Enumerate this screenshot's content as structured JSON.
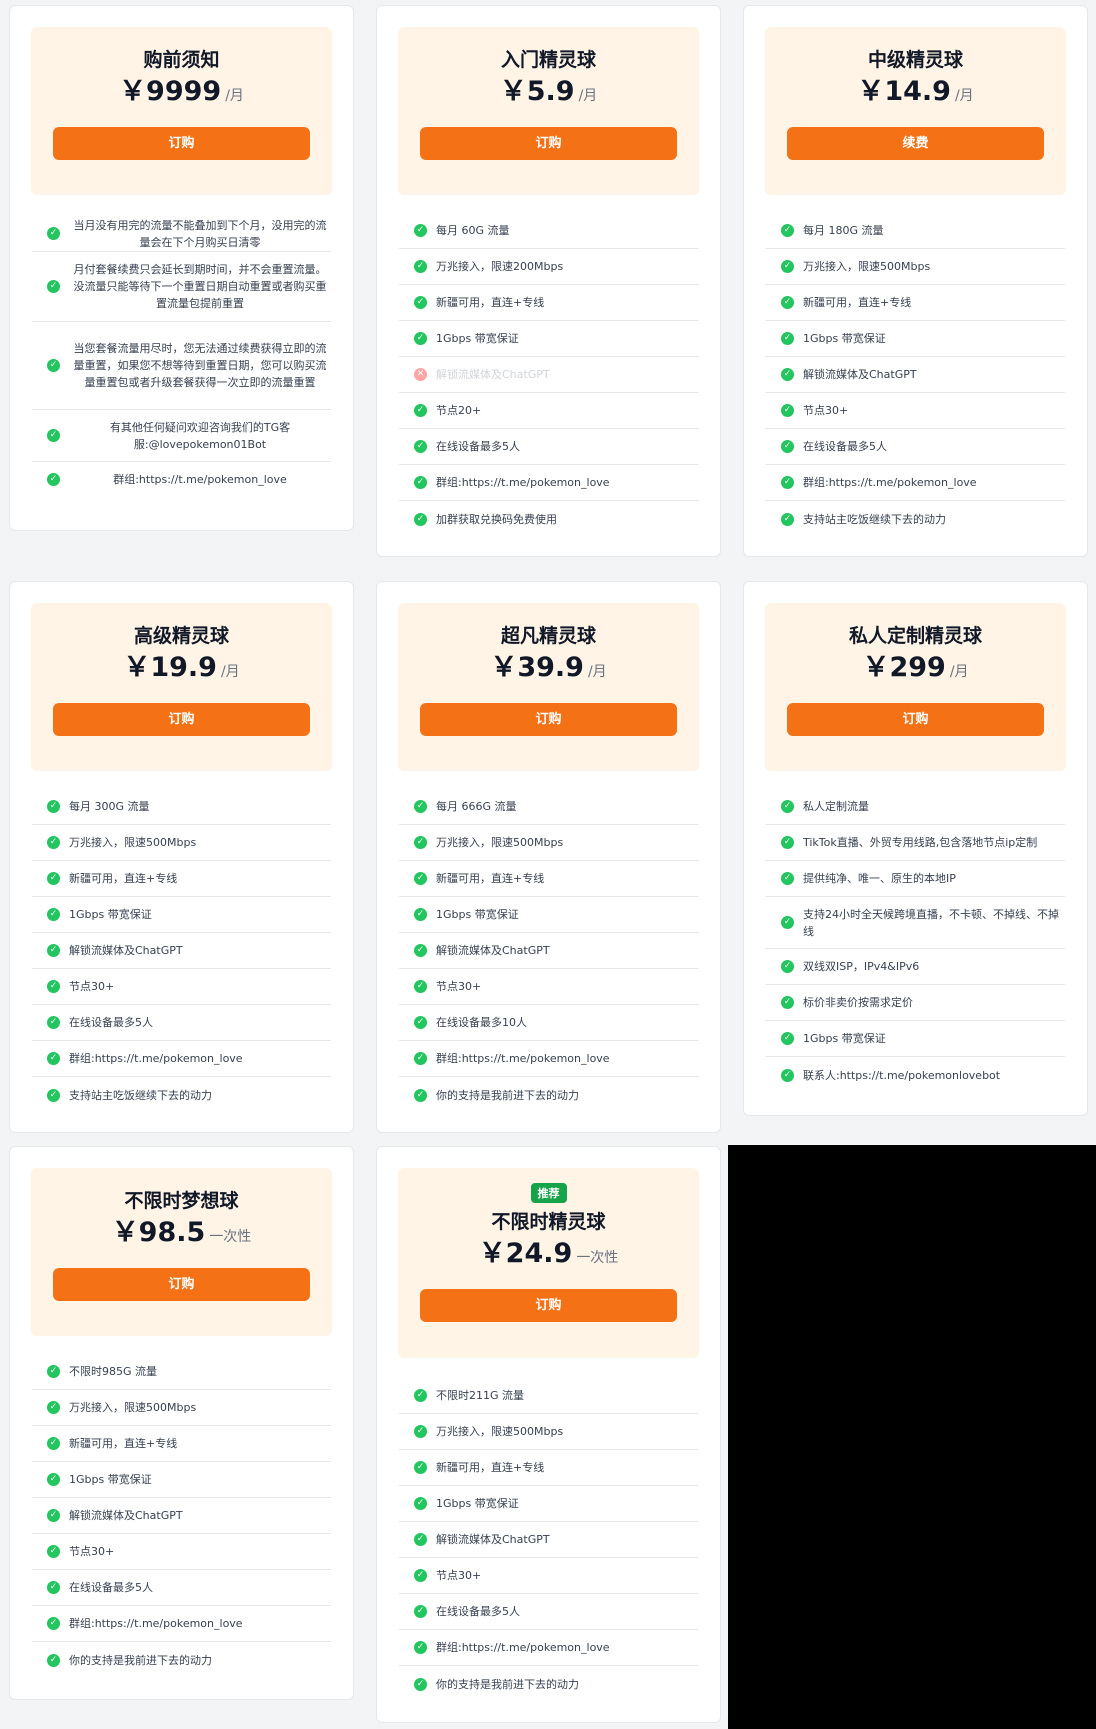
{
  "plans": [
    {
      "badge": "",
      "name": "购前须知",
      "price": "￥9999",
      "unit": "/月",
      "button": "订购",
      "features": [
        {
          "text": "当月没有用完的流量不能叠加到下个月，没用完的流量会在下个月购买日清零",
          "ok": true
        },
        {
          "text": "月付套餐续费只会延长到期时间，并不会重置流量。没流量只能等待下一个重置日期自动重置或者购买重置流量包提前重置",
          "ok": true
        },
        {
          "text": "当您套餐流量用尽时，您无法通过续费获得立即的流量重置，如果您不想等待到重置日期，您可以购买流量重置包或者升级套餐获得一次立即的流量重置",
          "ok": true
        },
        {
          "text": "有其他任何疑问欢迎咨询我们的TG客服:@lovepokemon01Bot",
          "ok": true
        },
        {
          "text": "群组:https://t.me/pokemon_love",
          "ok": true
        }
      ]
    },
    {
      "badge": "",
      "name": "入门精灵球",
      "price": "￥5.9",
      "unit": "/月",
      "button": "订购",
      "features": [
        {
          "text": "每月 60G 流量",
          "ok": true
        },
        {
          "text": "万兆接入，限速200Mbps",
          "ok": true
        },
        {
          "text": "新疆可用，直连+专线",
          "ok": true
        },
        {
          "text": "1Gbps 带宽保证",
          "ok": true
        },
        {
          "text": "解锁流媒体及ChatGPT",
          "ok": false
        },
        {
          "text": "节点20+",
          "ok": true
        },
        {
          "text": "在线设备最多5人",
          "ok": true
        },
        {
          "text": "群组:https://t.me/pokemon_love",
          "ok": true
        },
        {
          "text": "加群获取兑换码免费使用",
          "ok": true
        }
      ]
    },
    {
      "badge": "",
      "name": "中级精灵球",
      "price": "￥14.9",
      "unit": "/月",
      "button": "续费",
      "features": [
        {
          "text": "每月 180G 流量",
          "ok": true
        },
        {
          "text": "万兆接入，限速500Mbps",
          "ok": true
        },
        {
          "text": "新疆可用，直连+专线",
          "ok": true
        },
        {
          "text": "1Gbps 带宽保证",
          "ok": true
        },
        {
          "text": "解锁流媒体及ChatGPT",
          "ok": true
        },
        {
          "text": "节点30+",
          "ok": true
        },
        {
          "text": "在线设备最多5人",
          "ok": true
        },
        {
          "text": "群组:https://t.me/pokemon_love",
          "ok": true
        },
        {
          "text": "支持站主吃饭继续下去的动力",
          "ok": true
        }
      ]
    },
    {
      "badge": "",
      "name": "高级精灵球",
      "price": "￥19.9",
      "unit": "/月",
      "button": "订购",
      "features": [
        {
          "text": "每月 300G 流量",
          "ok": true
        },
        {
          "text": "万兆接入，限速500Mbps",
          "ok": true
        },
        {
          "text": "新疆可用，直连+专线",
          "ok": true
        },
        {
          "text": "1Gbps 带宽保证",
          "ok": true
        },
        {
          "text": "解锁流媒体及ChatGPT",
          "ok": true
        },
        {
          "text": "节点30+",
          "ok": true
        },
        {
          "text": "在线设备最多5人",
          "ok": true
        },
        {
          "text": "群组:https://t.me/pokemon_love",
          "ok": true
        },
        {
          "text": "支持站主吃饭继续下去的动力",
          "ok": true
        }
      ]
    },
    {
      "badge": "",
      "name": "超凡精灵球",
      "price": "￥39.9",
      "unit": "/月",
      "button": "订购",
      "features": [
        {
          "text": "每月 666G 流量",
          "ok": true
        },
        {
          "text": "万兆接入，限速500Mbps",
          "ok": true
        },
        {
          "text": "新疆可用，直连+专线",
          "ok": true
        },
        {
          "text": "1Gbps 带宽保证",
          "ok": true
        },
        {
          "text": "解锁流媒体及ChatGPT",
          "ok": true
        },
        {
          "text": "节点30+",
          "ok": true
        },
        {
          "text": "在线设备最多10人",
          "ok": true
        },
        {
          "text": "群组:https://t.me/pokemon_love",
          "ok": true
        },
        {
          "text": "你的支持是我前进下去的动力",
          "ok": true
        }
      ]
    },
    {
      "badge": "",
      "name": "私人定制精灵球",
      "price": "￥299",
      "unit": "/月",
      "button": "订购",
      "features": [
        {
          "text": "私人定制流量",
          "ok": true
        },
        {
          "text": "TikTok直播、外贸专用线路,包含落地节点ip定制",
          "ok": true
        },
        {
          "text": "提供纯净、唯一、原生的本地IP",
          "ok": true
        },
        {
          "text": "支持24小时全天候跨境直播，不卡顿、不掉线、不掉线",
          "ok": true
        },
        {
          "text": "双线双ISP，IPv4&IPv6",
          "ok": true
        },
        {
          "text": "标价非卖价按需求定价",
          "ok": true
        },
        {
          "text": "1Gbps 带宽保证",
          "ok": true
        },
        {
          "text": "联系人:https://t.me/pokemonlovebot",
          "ok": true
        }
      ]
    },
    {
      "badge": "",
      "name": "不限时梦想球",
      "price": "￥98.5",
      "unit": "一次性",
      "button": "订购",
      "features": [
        {
          "text": "不限时985G 流量",
          "ok": true
        },
        {
          "text": "万兆接入，限速500Mbps",
          "ok": true
        },
        {
          "text": "新疆可用，直连+专线",
          "ok": true
        },
        {
          "text": "1Gbps 带宽保证",
          "ok": true
        },
        {
          "text": "解锁流媒体及ChatGPT",
          "ok": true
        },
        {
          "text": "节点30+",
          "ok": true
        },
        {
          "text": "在线设备最多5人",
          "ok": true
        },
        {
          "text": "群组:https://t.me/pokemon_love",
          "ok": true
        },
        {
          "text": "你的支持是我前进下去的动力",
          "ok": true
        }
      ]
    },
    {
      "badge": "推荐",
      "name": "不限时精灵球",
      "price": "￥24.9",
      "unit": "一次性",
      "button": "订购",
      "features": [
        {
          "text": "不限时211G 流量",
          "ok": true
        },
        {
          "text": "万兆接入，限速500Mbps",
          "ok": true
        },
        {
          "text": "新疆可用，直连+专线",
          "ok": true
        },
        {
          "text": "1Gbps 带宽保证",
          "ok": true
        },
        {
          "text": "解锁流媒体及ChatGPT",
          "ok": true
        },
        {
          "text": "节点30+",
          "ok": true
        },
        {
          "text": "在线设备最多5人",
          "ok": true
        },
        {
          "text": "群组:https://t.me/pokemon_love",
          "ok": true
        },
        {
          "text": "你的支持是我前进下去的动力",
          "ok": true
        }
      ]
    }
  ]
}
